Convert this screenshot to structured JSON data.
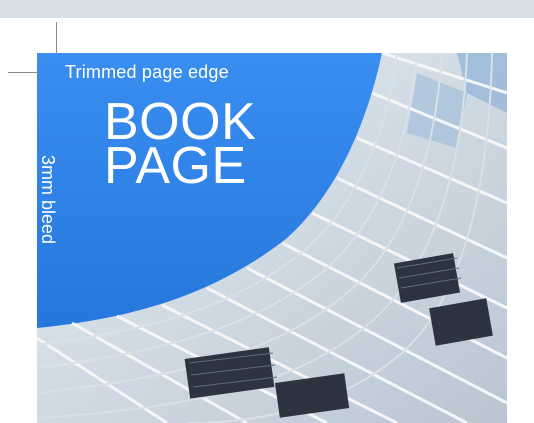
{
  "labels": {
    "trim_edge": "Trimmed page edge",
    "bleed": "3mm bleed"
  },
  "title": {
    "line1": "BOOK",
    "line2": "PAGE"
  },
  "colors": {
    "sky": "#2f86ea",
    "crop_mark": "#8a8a8a",
    "top_band": "#d7dfe7",
    "text": "#ffffff"
  }
}
